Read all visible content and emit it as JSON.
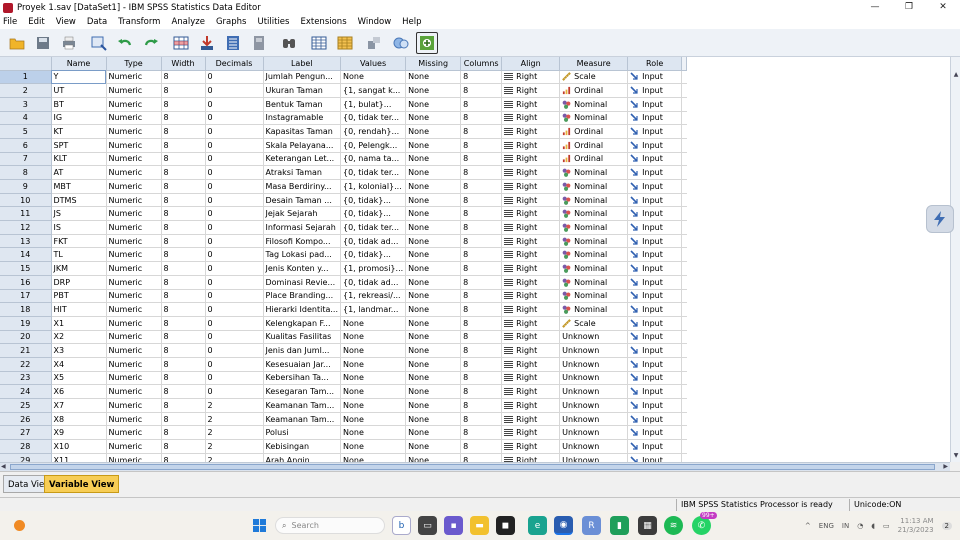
{
  "window": {
    "title": "Proyek 1.sav [DataSet1] - IBM SPSS Statistics Data Editor",
    "minimize": "—",
    "maximize": "❐",
    "close": "✕"
  },
  "menu": [
    "File",
    "Edit",
    "View",
    "Data",
    "Transform",
    "Analyze",
    "Graphs",
    "Utilities",
    "Extensions",
    "Window",
    "Help"
  ],
  "toolbar": [
    "open-icon",
    "save-icon",
    "print-icon",
    "dialog-recall-icon",
    "undo-icon",
    "redo-icon",
    "go-to-case-icon",
    "go-to-variable-icon",
    "variables-icon",
    "insert-cases-icon",
    "split-file-icon",
    "find-icon",
    "weight-cases-icon",
    "select-cases-icon",
    "value-labels-icon",
    "use-sets-icon",
    "spelling-icon"
  ],
  "columns": [
    "Name",
    "Type",
    "Width",
    "Decimals",
    "Label",
    "Values",
    "Missing",
    "Columns",
    "Align",
    "Measure",
    "Role"
  ],
  "rows": [
    {
      "n": "1",
      "name": "Y",
      "type": "Numeric",
      "width": "8",
      "dec": "0",
      "label": "Jumlah Pengun...",
      "values": "None",
      "missing": "None",
      "cols": "8",
      "align": "Right",
      "measure": "Scale",
      "role": "Input"
    },
    {
      "n": "2",
      "name": "UT",
      "type": "Numeric",
      "width": "8",
      "dec": "0",
      "label": "Ukuran Taman",
      "values": "{1, sangat k...",
      "missing": "None",
      "cols": "8",
      "align": "Right",
      "measure": "Ordinal",
      "role": "Input"
    },
    {
      "n": "3",
      "name": "BT",
      "type": "Numeric",
      "width": "8",
      "dec": "0",
      "label": "Bentuk Taman",
      "values": "{1, bulat}...",
      "missing": "None",
      "cols": "8",
      "align": "Right",
      "measure": "Nominal",
      "role": "Input"
    },
    {
      "n": "4",
      "name": "IG",
      "type": "Numeric",
      "width": "8",
      "dec": "0",
      "label": "Instagramable",
      "values": "{0, tidak ter...",
      "missing": "None",
      "cols": "8",
      "align": "Right",
      "measure": "Nominal",
      "role": "Input"
    },
    {
      "n": "5",
      "name": "KT",
      "type": "Numeric",
      "width": "8",
      "dec": "0",
      "label": "Kapasitas Taman",
      "values": "{0, rendah}...",
      "missing": "None",
      "cols": "8",
      "align": "Right",
      "measure": "Ordinal",
      "role": "Input"
    },
    {
      "n": "6",
      "name": "SPT",
      "type": "Numeric",
      "width": "8",
      "dec": "0",
      "label": "Skala Pelayana...",
      "values": "{0, Pelengk...",
      "missing": "None",
      "cols": "8",
      "align": "Right",
      "measure": "Ordinal",
      "role": "Input"
    },
    {
      "n": "7",
      "name": "KLT",
      "type": "Numeric",
      "width": "8",
      "dec": "0",
      "label": "Keterangan Let...",
      "values": "{0, nama ta...",
      "missing": "None",
      "cols": "8",
      "align": "Right",
      "measure": "Ordinal",
      "role": "Input"
    },
    {
      "n": "8",
      "name": "AT",
      "type": "Numeric",
      "width": "8",
      "dec": "0",
      "label": "Atraksi Taman",
      "values": "{0, tidak ter...",
      "missing": "None",
      "cols": "8",
      "align": "Right",
      "measure": "Nominal",
      "role": "Input"
    },
    {
      "n": "9",
      "name": "MBT",
      "type": "Numeric",
      "width": "8",
      "dec": "0",
      "label": "Masa Berdiriny...",
      "values": "{1, kolonial}...",
      "missing": "None",
      "cols": "8",
      "align": "Right",
      "measure": "Nominal",
      "role": "Input"
    },
    {
      "n": "10",
      "name": "DTMS",
      "type": "Numeric",
      "width": "8",
      "dec": "0",
      "label": "Desain Taman ...",
      "values": "{0, tidak}...",
      "missing": "None",
      "cols": "8",
      "align": "Right",
      "measure": "Nominal",
      "role": "Input"
    },
    {
      "n": "11",
      "name": "JS",
      "type": "Numeric",
      "width": "8",
      "dec": "0",
      "label": "Jejak Sejarah",
      "values": "{0, tidak}...",
      "missing": "None",
      "cols": "8",
      "align": "Right",
      "measure": "Nominal",
      "role": "Input"
    },
    {
      "n": "12",
      "name": "IS",
      "type": "Numeric",
      "width": "8",
      "dec": "0",
      "label": "Informasi Sejarah",
      "values": "{0, tidak ter...",
      "missing": "None",
      "cols": "8",
      "align": "Right",
      "measure": "Nominal",
      "role": "Input"
    },
    {
      "n": "13",
      "name": "FKT",
      "type": "Numeric",
      "width": "8",
      "dec": "0",
      "label": "Filosofi Kompo...",
      "values": "{0, tidak ad...",
      "missing": "None",
      "cols": "8",
      "align": "Right",
      "measure": "Nominal",
      "role": "Input"
    },
    {
      "n": "14",
      "name": "TL",
      "type": "Numeric",
      "width": "8",
      "dec": "0",
      "label": "Tag Lokasi pad...",
      "values": "{0, tidak}...",
      "missing": "None",
      "cols": "8",
      "align": "Right",
      "measure": "Nominal",
      "role": "Input"
    },
    {
      "n": "15",
      "name": "JKM",
      "type": "Numeric",
      "width": "8",
      "dec": "0",
      "label": "Jenis Konten y...",
      "values": "{1, promosi}...",
      "missing": "None",
      "cols": "8",
      "align": "Right",
      "measure": "Nominal",
      "role": "Input"
    },
    {
      "n": "16",
      "name": "DRP",
      "type": "Numeric",
      "width": "8",
      "dec": "0",
      "label": "Dominasi Revie...",
      "values": "{0, tidak ad...",
      "missing": "None",
      "cols": "8",
      "align": "Right",
      "measure": "Nominal",
      "role": "Input"
    },
    {
      "n": "17",
      "name": "PBT",
      "type": "Numeric",
      "width": "8",
      "dec": "0",
      "label": "Place Branding...",
      "values": "{1, rekreasi/...",
      "missing": "None",
      "cols": "8",
      "align": "Right",
      "measure": "Nominal",
      "role": "Input"
    },
    {
      "n": "18",
      "name": "HIT",
      "type": "Numeric",
      "width": "8",
      "dec": "0",
      "label": "Hierarki Identita...",
      "values": "{1, landmar...",
      "missing": "None",
      "cols": "8",
      "align": "Right",
      "measure": "Nominal",
      "role": "Input"
    },
    {
      "n": "19",
      "name": "X1",
      "type": "Numeric",
      "width": "8",
      "dec": "0",
      "label": "Kelengkapan F...",
      "values": "None",
      "missing": "None",
      "cols": "8",
      "align": "Right",
      "measure": "Scale",
      "role": "Input"
    },
    {
      "n": "20",
      "name": "X2",
      "type": "Numeric",
      "width": "8",
      "dec": "0",
      "label": "Kualitas Fasilitas",
      "values": "None",
      "missing": "None",
      "cols": "8",
      "align": "Right",
      "measure": "Unknown",
      "role": "Input"
    },
    {
      "n": "21",
      "name": "X3",
      "type": "Numeric",
      "width": "8",
      "dec": "0",
      "label": "Jenis dan Juml...",
      "values": "None",
      "missing": "None",
      "cols": "8",
      "align": "Right",
      "measure": "Unknown",
      "role": "Input"
    },
    {
      "n": "22",
      "name": "X4",
      "type": "Numeric",
      "width": "8",
      "dec": "0",
      "label": "Kesesuaian Jar...",
      "values": "None",
      "missing": "None",
      "cols": "8",
      "align": "Right",
      "measure": "Unknown",
      "role": "Input"
    },
    {
      "n": "23",
      "name": "X5",
      "type": "Numeric",
      "width": "8",
      "dec": "0",
      "label": "Kebersihan Ta...",
      "values": "None",
      "missing": "None",
      "cols": "8",
      "align": "Right",
      "measure": "Unknown",
      "role": "Input"
    },
    {
      "n": "24",
      "name": "X6",
      "type": "Numeric",
      "width": "8",
      "dec": "0",
      "label": "Kesegaran Tam...",
      "values": "None",
      "missing": "None",
      "cols": "8",
      "align": "Right",
      "measure": "Unknown",
      "role": "Input"
    },
    {
      "n": "25",
      "name": "X7",
      "type": "Numeric",
      "width": "8",
      "dec": "2",
      "label": "Keamanan Tam...",
      "values": "None",
      "missing": "None",
      "cols": "8",
      "align": "Right",
      "measure": "Unknown",
      "role": "Input"
    },
    {
      "n": "26",
      "name": "X8",
      "type": "Numeric",
      "width": "8",
      "dec": "2",
      "label": "Keamanan Tam...",
      "values": "None",
      "missing": "None",
      "cols": "8",
      "align": "Right",
      "measure": "Unknown",
      "role": "Input"
    },
    {
      "n": "27",
      "name": "X9",
      "type": "Numeric",
      "width": "8",
      "dec": "2",
      "label": "Polusi",
      "values": "None",
      "missing": "None",
      "cols": "8",
      "align": "Right",
      "measure": "Unknown",
      "role": "Input"
    },
    {
      "n": "28",
      "name": "X10",
      "type": "Numeric",
      "width": "8",
      "dec": "2",
      "label": "Kebisingan",
      "values": "None",
      "missing": "None",
      "cols": "8",
      "align": "Right",
      "measure": "Unknown",
      "role": "Input"
    },
    {
      "n": "29",
      "name": "X11",
      "type": "Numeric",
      "width": "8",
      "dec": "2",
      "label": "Arah Angin",
      "values": "None",
      "missing": "None",
      "cols": "8",
      "align": "Right",
      "measure": "Unknown",
      "role": "Input"
    }
  ],
  "tabs": {
    "data_view": "Data View",
    "variable_view": "Variable View"
  },
  "status": {
    "processor": "IBM SPSS Statistics Processor is ready",
    "unicode": "Unicode:ON"
  },
  "taskbar": {
    "search_placeholder": "Search",
    "tray": [
      "^",
      "ENG",
      "IN"
    ],
    "clock_time": "11:13 AM",
    "clock_date": "21/3/2023",
    "notif_badge": "99+",
    "notif_count": "2"
  },
  "colors": {
    "accent": "#dde6f1",
    "active_tab": "#f7cd55",
    "scale": "#c49a2c",
    "ordinal": "#c0392b",
    "nominal": "#7a5aa8"
  }
}
